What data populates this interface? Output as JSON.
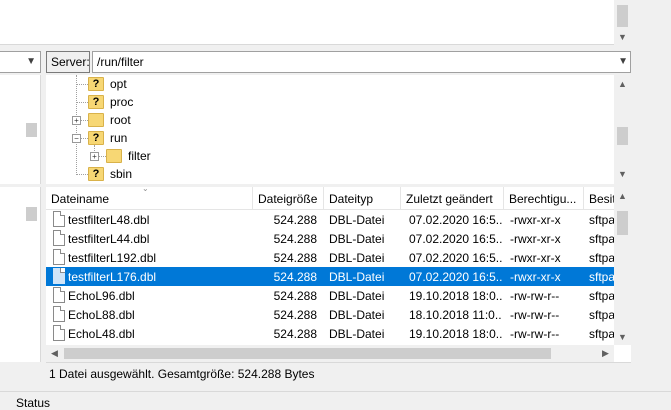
{
  "server": {
    "label": "Server:",
    "path": "/run/filter"
  },
  "tree": [
    {
      "name": "opt",
      "unknown": true
    },
    {
      "name": "proc",
      "unknown": true
    },
    {
      "name": "root",
      "unknown": false
    },
    {
      "name": "run",
      "unknown": true
    },
    {
      "name": "filter",
      "unknown": false
    },
    {
      "name": "sbin",
      "unknown": true
    }
  ],
  "columns": [
    "Dateiname",
    "Dateigröße",
    "Dateityp",
    "Zuletzt geändert",
    "Berechtigu...",
    "Besit"
  ],
  "files": [
    {
      "name": "testfilterL48.dbl",
      "size": "524.288",
      "type": "DBL-Datei",
      "modified": "07.02.2020 16:5...",
      "perms": "-rwxr-xr-x",
      "owner": "sftpa"
    },
    {
      "name": "testfilterL44.dbl",
      "size": "524.288",
      "type": "DBL-Datei",
      "modified": "07.02.2020 16:5...",
      "perms": "-rwxr-xr-x",
      "owner": "sftpa"
    },
    {
      "name": "testfilterL192.dbl",
      "size": "524.288",
      "type": "DBL-Datei",
      "modified": "07.02.2020 16:5...",
      "perms": "-rwxr-xr-x",
      "owner": "sftpa"
    },
    {
      "name": "testfilterL176.dbl",
      "size": "524.288",
      "type": "DBL-Datei",
      "modified": "07.02.2020 16:5...",
      "perms": "-rwxr-xr-x",
      "owner": "sftpa"
    },
    {
      "name": "EchoL96.dbl",
      "size": "524.288",
      "type": "DBL-Datei",
      "modified": "19.10.2018 18:0...",
      "perms": "-rw-rw-r--",
      "owner": "sftpa"
    },
    {
      "name": "EchoL88.dbl",
      "size": "524.288",
      "type": "DBL-Datei",
      "modified": "18.10.2018 11:0...",
      "perms": "-rw-rw-r--",
      "owner": "sftpa"
    },
    {
      "name": "EchoL48.dbl",
      "size": "524.288",
      "type": "DBL-Datei",
      "modified": "19.10.2018 18:0...",
      "perms": "-rw-rw-r--",
      "owner": "sftpa"
    }
  ],
  "selected_row": 3,
  "status_text": "1 Datei ausgewählt. Gesamtgröße: 524.288 Bytes",
  "bottom_tab": "Status",
  "colors": {
    "selection": "#0078d7",
    "folder": "#f7d774"
  }
}
